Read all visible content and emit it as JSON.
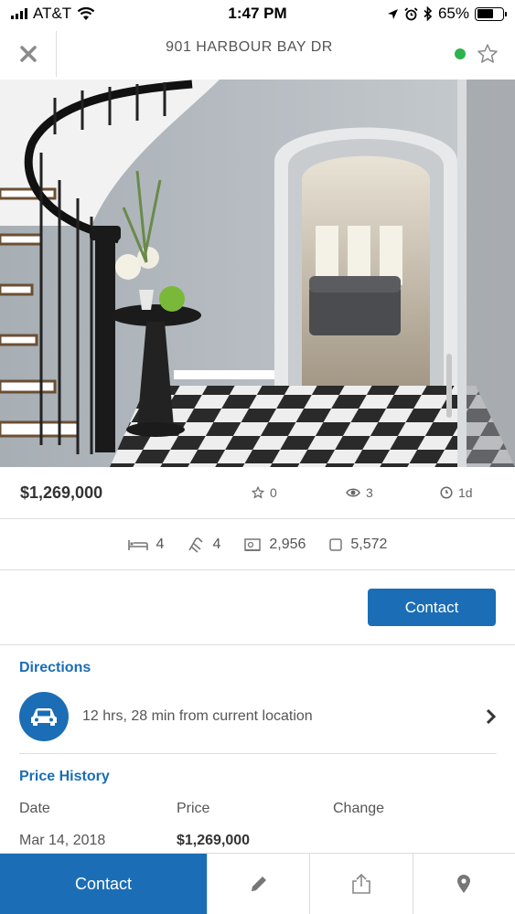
{
  "status_bar": {
    "carrier": "AT&T",
    "time": "1:47 PM",
    "battery": "65%",
    "battery_level": 0.65
  },
  "header": {
    "title": "901 HARBOUR BAY DR",
    "close_icon": "close-icon",
    "favorite_icon": "star-outline-icon",
    "status_color": "#2db34a"
  },
  "listing": {
    "price": "$1,269,000",
    "favorites": "0",
    "views": "3",
    "days_on_market": "1d",
    "beds": "4",
    "baths": "4",
    "sqft": "2,956",
    "lot": "5,572"
  },
  "actions": {
    "contact_label": "Contact"
  },
  "directions": {
    "title": "Directions",
    "text": "12 hrs, 28 min from current location"
  },
  "price_history": {
    "title": "Price History",
    "columns": [
      "Date",
      "Price",
      "Change"
    ],
    "rows": [
      {
        "date": "Mar 14, 2018",
        "price": "$1,269,000",
        "change": ""
      }
    ]
  },
  "bottom_bar": {
    "contact_label": "Contact",
    "icons": [
      "pencil-icon",
      "share-icon",
      "map-pin-icon"
    ]
  },
  "colors": {
    "accent": "#1b6db5",
    "online": "#2db34a"
  }
}
